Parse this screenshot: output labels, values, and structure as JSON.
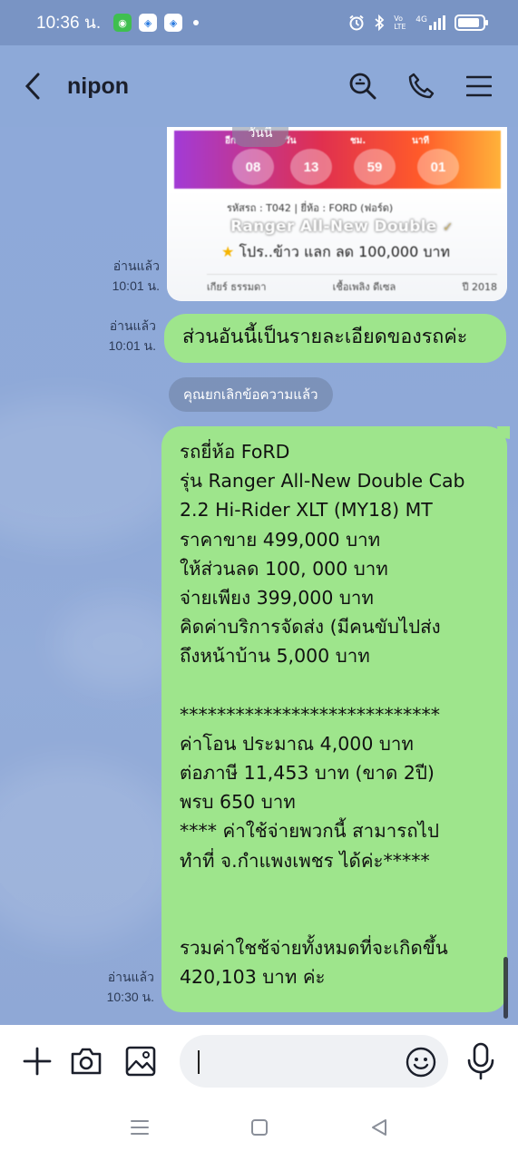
{
  "status_bar": {
    "time": "10:36 น.",
    "network": "4G",
    "volte": "Vo LTE"
  },
  "header": {
    "contact_name": "nipon"
  },
  "chat": {
    "date_badge": "วันนี้",
    "image_message": {
      "timer_labels": [
        "อีก",
        "วัน",
        "ชม.",
        "นาที"
      ],
      "countdown": [
        "08",
        "13",
        "59",
        "01"
      ],
      "details_line": "รหัสรถ : T042 | ยี่ห้อ : FORD (ฟอร์ด)",
      "model_title": "Ranger All-New Double",
      "promo_line": "โปร..ข้าว แลก ลด 100,000 บาท",
      "spec_gear": "เกียร์ ธรรมดา",
      "spec_fuel": "เชื้อเพลิง ดีเซล",
      "spec_year": "ปี 2018",
      "read_label": "อ่านแล้ว",
      "time": "10:01 น."
    },
    "short_message": {
      "text": "ส่วนอันนี้เป็นรายละเอียดของรถค่ะ",
      "read_label": "อ่านแล้ว",
      "time": "10:01 น."
    },
    "system_note": "คุณยกเลิกข้อความแล้ว",
    "long_message": {
      "lines": [
        "รถยี่ห้อ FoRD",
        "รุ่น  Ranger All-New Double Cab",
        "2.2 Hi-Rider XLT (MY18) MT",
        "ราคาขาย 499,000 บาท",
        "ให้ส่วนลด 100, 000 บาท",
        "จ่ายเพียง 399,000 บาท",
        "คิดค่าบริการจัดส่ง (มีคนขับไปส่ง",
        "ถึงหน้าบ้าน 5,000 บาท",
        "",
        "****************************",
        "ค่าโอน ประมาณ 4,000 บาท",
        "ต่อภาษี 11,453 บาท (ขาด 2ปี)",
        "พรบ 650 บาท",
        "**** ค่าใช้จ่ายพวกนี้ สามารถไป",
        "ทำที่ จ.กำแพงเพชร ได้ค่ะ*****",
        "",
        "",
        "รวมค่าใชช้จ่ายทั้งหมดที่จะเกิดขึ้น",
        "420,103 บาท ค่ะ"
      ],
      "read_label": "อ่านแล้ว",
      "time": "10:30 น."
    }
  },
  "input": {
    "value": ""
  },
  "colors": {
    "chat_background": "#8da9d8",
    "bubble_green": "#9ee58c",
    "header_text": "#1b1f2b"
  }
}
